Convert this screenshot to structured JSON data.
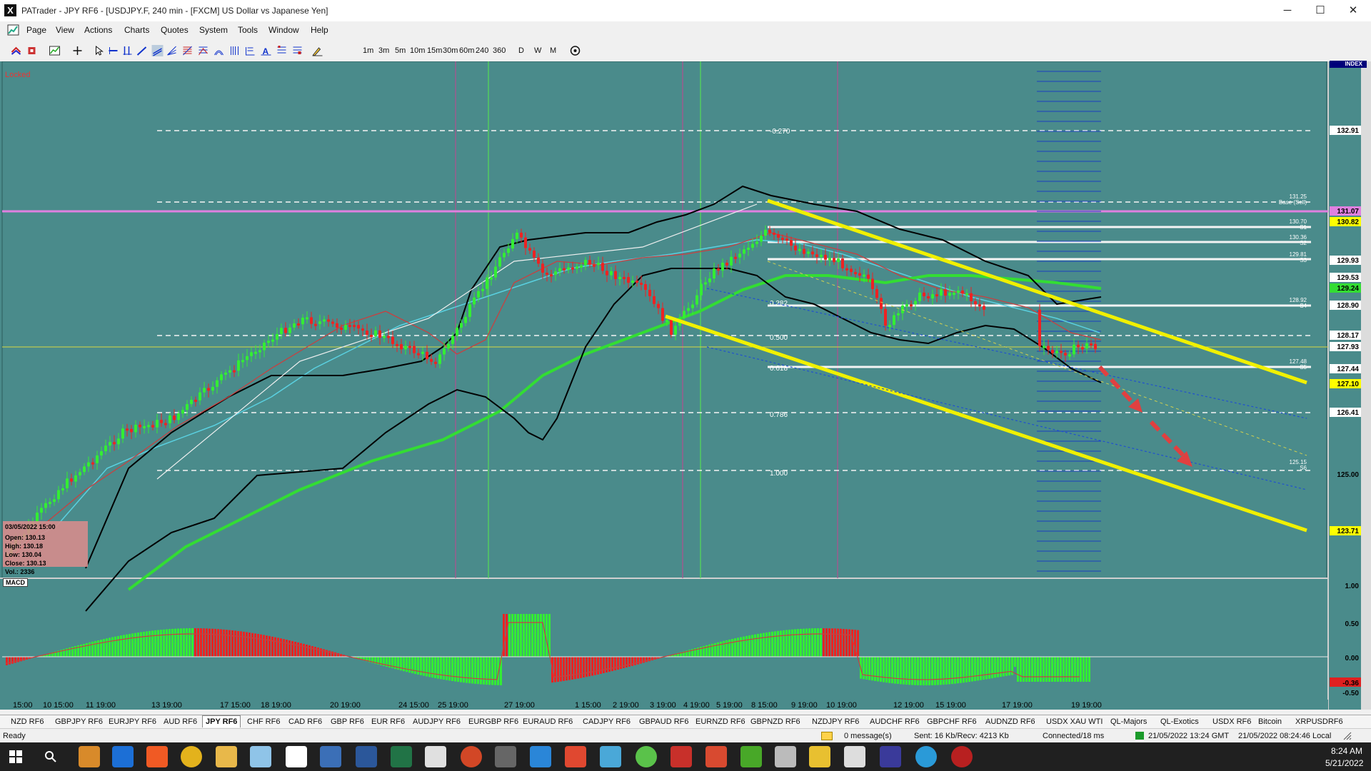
{
  "window": {
    "title": "PATrader - JPY RF6 - [USDJPY.F, 240 min - [FXCM] US Dollar vs Japanese Yen]",
    "logo": "X",
    "controls": {
      "minimize": "─",
      "maximize": "☐",
      "close": "✕"
    },
    "mdi_controls": {
      "minimize": "_",
      "restore": "❐",
      "close": "✕"
    }
  },
  "menu": [
    "Page",
    "View",
    "Actions",
    "Charts",
    "Quotes",
    "System",
    "Tools",
    "Window",
    "Help"
  ],
  "toolbar": {
    "timeframes": [
      "1m",
      "3m",
      "5m",
      "10m",
      "15m",
      "30m",
      "60m",
      "240",
      "360"
    ],
    "periods": [
      "D",
      "W",
      "M"
    ]
  },
  "chart": {
    "locked_label": "Locked",
    "index_label": "INDEX",
    "indicator_label": "MACD",
    "price_labels": [
      {
        "text": "132.91",
        "style": "white"
      },
      {
        "text": "131.07",
        "style": "magenta"
      },
      {
        "text": "130.82",
        "style": "yellow"
      },
      {
        "text": "129.93",
        "style": "white"
      },
      {
        "text": "129.53",
        "style": "white"
      },
      {
        "text": "129.24",
        "style": "green"
      },
      {
        "text": "128.90",
        "style": "white"
      },
      {
        "text": "128.17",
        "style": "white"
      },
      {
        "text": "127.93",
        "style": "white"
      },
      {
        "text": "127.44",
        "style": "white"
      },
      {
        "text": "127.10",
        "style": "yellow"
      },
      {
        "text": "126.41",
        "style": "white"
      },
      {
        "text": "125.00",
        "style": "plain"
      },
      {
        "text": "123.71",
        "style": "yellow"
      }
    ],
    "macd_scale": [
      "1.00",
      "0.50",
      "0.00",
      "-0.36",
      "-0.50"
    ],
    "fib_labels": [
      "-0.270",
      "0.382",
      "0.500",
      "0.618",
      "0.786",
      "1.000"
    ],
    "pivot_labels": [
      {
        "value": "131.25",
        "name": "Base (Sell)"
      },
      {
        "value": "130.70",
        "name": "S1"
      },
      {
        "value": "130.36",
        "name": "S2"
      },
      {
        "value": "129.81",
        "name": "S3"
      },
      {
        "value": "128.92",
        "name": "S4"
      },
      {
        "value": "127.48",
        "name": "S5"
      },
      {
        "value": "125.15",
        "name": "S6"
      }
    ],
    "time_axis": [
      "15:00",
      "10 15:00",
      "11 19:00",
      "13 19:00",
      "17 15:00",
      "18 19:00",
      "20 19:00",
      "24 15:00",
      "25 19:00",
      "27 19:00",
      "1 15:00",
      "2 19:00",
      "3 19:00",
      "4 19:00",
      "5 19:00",
      "8 15:00",
      "9 19:00",
      "10 19:00",
      "12 19:00",
      "15 19:00",
      "17 19:00",
      "19 19:00"
    ],
    "info_box": {
      "date": "03/05/2022 15:00",
      "open": "Open: 130.13",
      "high": "High: 130.18",
      "low": "Low: 130.04",
      "close": "Close: 130.13",
      "vol": "Vol.: 2336"
    }
  },
  "tabs": [
    "NZD RF6",
    "GBPJPY RF6",
    "EURJPY RF6",
    "AUD RF6",
    "JPY RF6",
    "CHF RF6",
    "CAD RF6",
    "GBP RF6",
    "EUR RF6",
    "AUDJPY RF6",
    "EURGBP RF6",
    "EURAUD RF6",
    "CADJPY RF6",
    "GBPAUD RF6",
    "EURNZD RF6",
    "GBPNZD RF6",
    "NZDJPY RF6",
    "AUDCHF RF6",
    "GBPCHF RF6",
    "AUDNZD RF6",
    "USDX XAU WTI",
    "QL-Majors",
    "QL-Exotics",
    "USDX RF6",
    "Bitcoin",
    "XRPUSDRF6"
  ],
  "active_tab": "JPY RF6",
  "status": {
    "ready": "Ready",
    "messages": "0 message(s)",
    "traffic": "Sent: 16 Kb/Recv: 4213 Kb",
    "connection": "Connected/18 ms",
    "gmt": "21/05/2022 13:24 GMT",
    "local": "21/05/2022 08:24:46 Local"
  },
  "taskbar": {
    "time": "8:24 AM",
    "date": "5/21/2022"
  },
  "colors": {
    "chart_bg": "#4a8b8b",
    "bull": "#33ee33",
    "bear": "#ee2222",
    "channel": "#f0f000",
    "pivot_magenta": "#e080e0"
  }
}
